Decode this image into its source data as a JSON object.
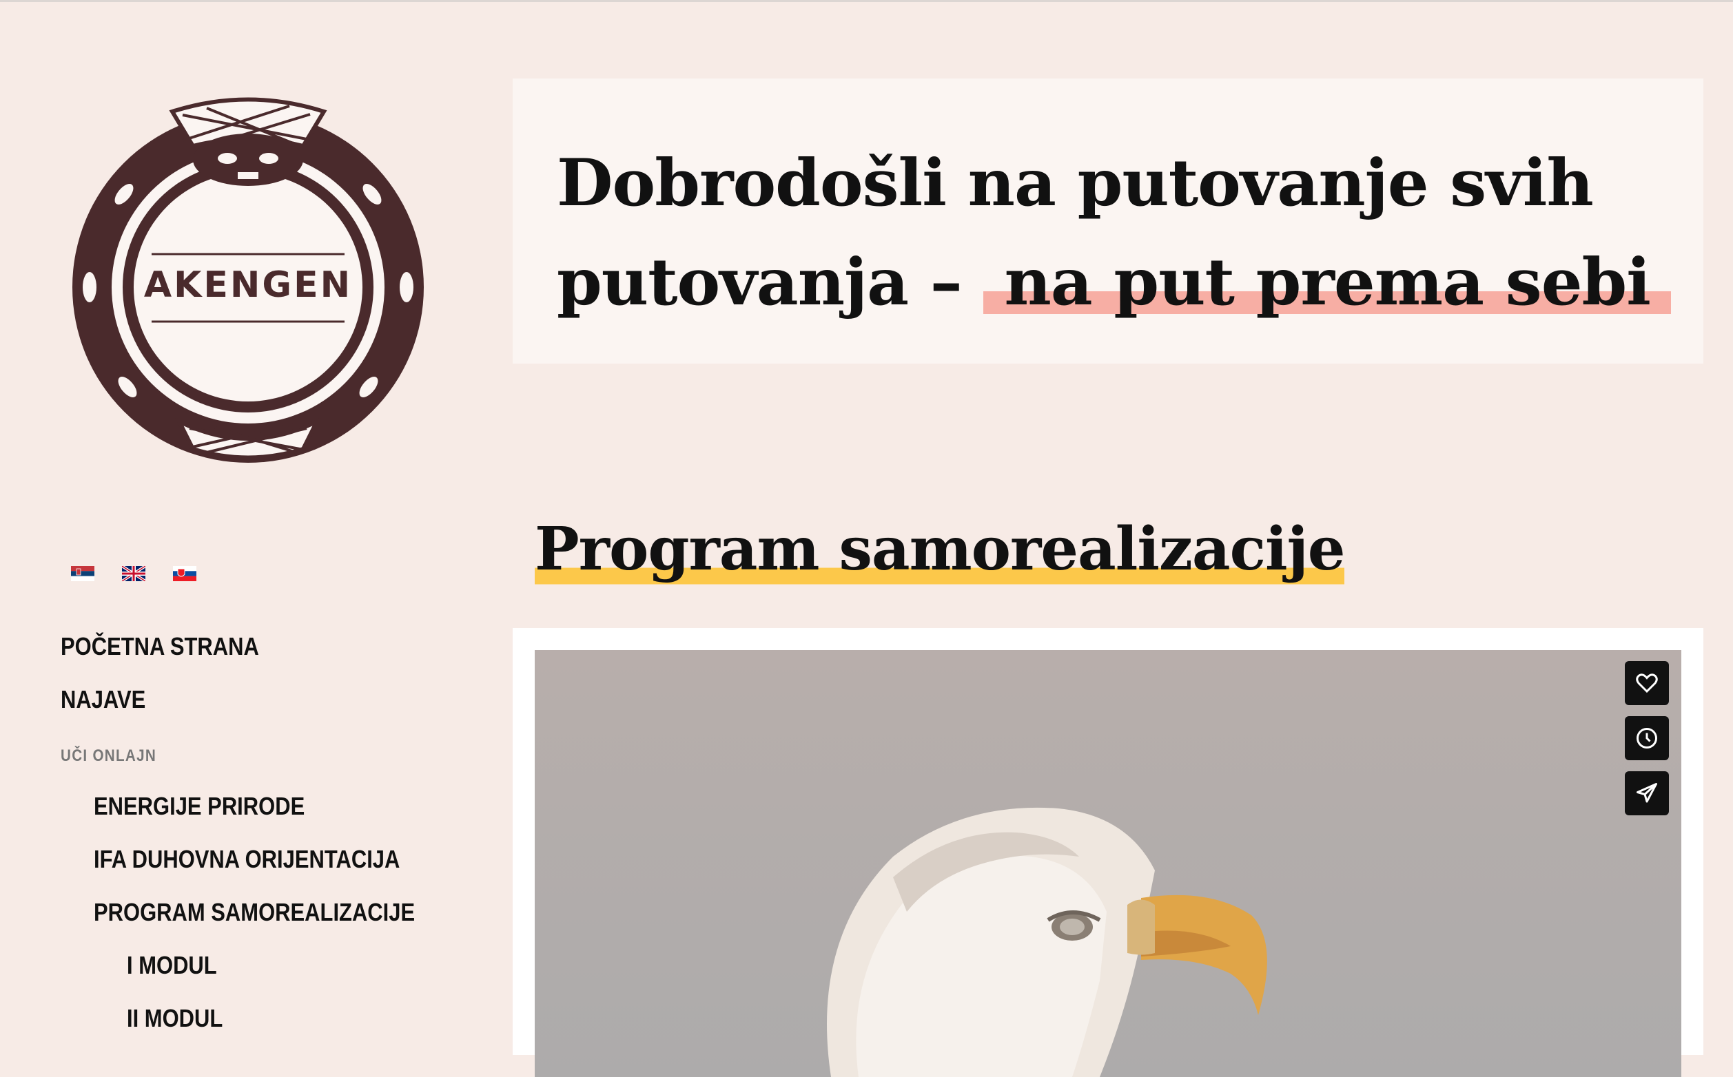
{
  "logo": {
    "text": "AKENGEN"
  },
  "languages": [
    {
      "name": "flag-serbia-icon"
    },
    {
      "name": "flag-uk-icon"
    },
    {
      "name": "flag-slovakia-icon"
    }
  ],
  "nav": {
    "home": "POČETNA STRANA",
    "announcements": "NAJAVE",
    "learn_online": "UČI ONLAJN",
    "nature_energies": "ENERGIJE PRIRODE",
    "ifa": "IFA DUHOVNA ORIJENTACIJA",
    "program": "PROGRAM SAMOREALIZACIJE",
    "module1": "I MODUL",
    "module2": "II MODUL"
  },
  "hero": {
    "line1": "Dobrodošli na putovanje svih",
    "line2_plain": "putovanja – ",
    "line2_highlight": "na put prema sebi",
    "highlight_color": "#f7aea4"
  },
  "section": {
    "title": "Program samorealizacije",
    "highlight_color": "#fcc84a"
  },
  "video": {
    "buttons": [
      "heart-icon",
      "clock-icon",
      "send-icon"
    ]
  },
  "colors": {
    "background": "#f7ebe6",
    "logo_brown": "#4a2a2c"
  }
}
